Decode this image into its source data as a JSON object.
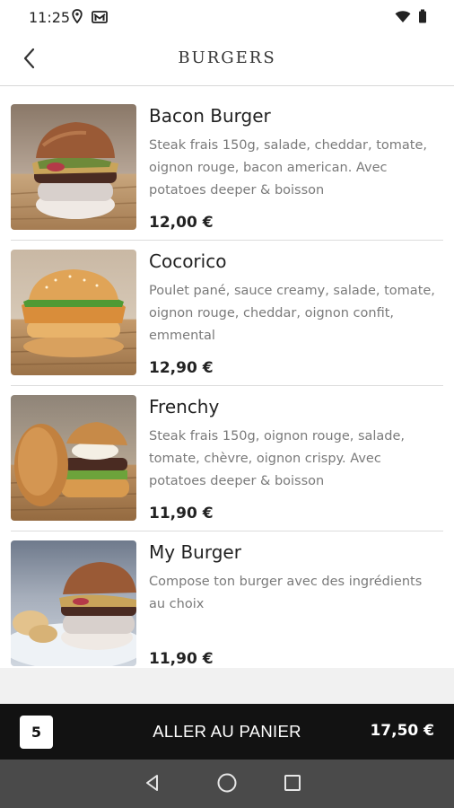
{
  "status_bar": {
    "time": "11:25",
    "icons": [
      "location-icon",
      "gmail-icon",
      "wifi-icon",
      "battery-icon"
    ]
  },
  "header": {
    "title": "BURGERS",
    "back_icon": "chevron-left-icon"
  },
  "products": [
    {
      "name": "Bacon Burger",
      "description": "Steak frais 150g, salade, cheddar, tomate, oignon rouge, bacon american. Avec potatoes deeper & boisson",
      "price": "12,00 €"
    },
    {
      "name": "Cocorico",
      "description": "Poulet pané, sauce creamy, salade, tomate, oignon rouge, cheddar, oignon confit, emmental",
      "price": "12,90 €"
    },
    {
      "name": "Frenchy",
      "description": "Steak frais 150g, oignon rouge, salade, tomate, chèvre, oignon crispy. Avec potatoes deeper & boisson",
      "price": "11,90 €"
    },
    {
      "name": "My Burger",
      "description": "Compose ton burger avec des ingrédients au choix",
      "price": "11,90 €"
    }
  ],
  "cart": {
    "count": "5",
    "label": "ALLER AU PANIER",
    "total": "17,50 €"
  },
  "colors": {
    "cart_bar": "#121212",
    "nav_bar": "#4a4a4a",
    "price": "#222222",
    "description": "#7a7a7a"
  }
}
